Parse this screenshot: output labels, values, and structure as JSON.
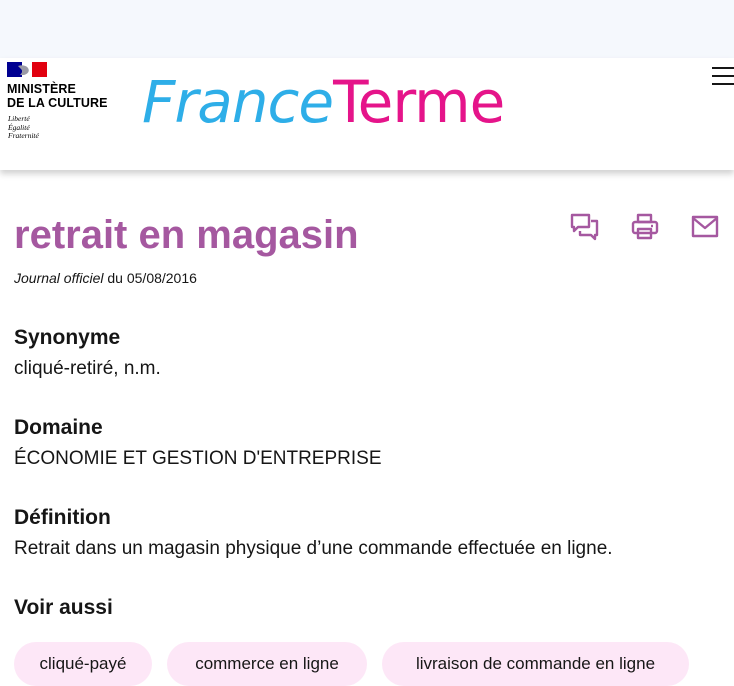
{
  "header": {
    "ministry_line1": "MINISTÈRE",
    "ministry_line2": "DE LA CULTURE",
    "motto_line1": "Liberté",
    "motto_line2": "Égalité",
    "motto_line3": "Fraternité",
    "brand_part1": "France",
    "brand_part2": "Terme",
    "menu_icon": "hamburger-menu-icon"
  },
  "term": {
    "title": "retrait en magasin",
    "journal_label": "Journal officiel",
    "journal_date": " du 05/08/2016"
  },
  "actions": {
    "icons": [
      "comment-icon",
      "print-icon",
      "mail-icon"
    ]
  },
  "sections": {
    "synonyme_label": "Synonyme",
    "synonyme_value": "cliqué-retiré, n.m.",
    "domaine_label": "Domaine",
    "domaine_value": "ÉCONOMIE ET GESTION D'ENTREPRISE",
    "definition_label": "Définition",
    "definition_value": "Retrait dans un magasin physique d’une commande effectuée en ligne.",
    "voir_aussi_label": "Voir aussi"
  },
  "see_also": [
    "cliqué-payé",
    "commerce en ligne",
    "livraison de commande en ligne"
  ],
  "colors": {
    "title_purple": "#a558a0",
    "brand_blue": "#2eaee8",
    "brand_pink": "#e5148a",
    "tag_background": "#fde7f7",
    "marianne_blue": "#000091",
    "marianne_red": "#e1000f"
  }
}
